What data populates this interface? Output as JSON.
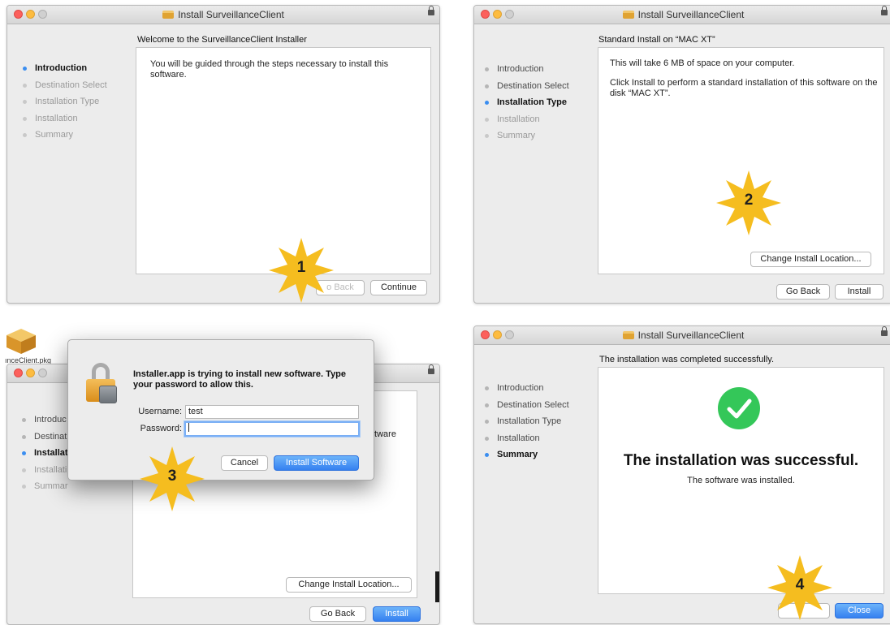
{
  "app_title": "Install SurveillanceClient",
  "steps": [
    "Introduction",
    "Destination Select",
    "Installation Type",
    "Installation",
    "Summary"
  ],
  "panel1": {
    "heading": "Welcome to the SurveillanceClient Installer",
    "text": "You will be guided through the steps necessary to install this software.",
    "go_back": "o Back",
    "continue": "Continue",
    "badge": "1"
  },
  "panel2": {
    "heading": "Standard Install on “MAC XT”",
    "space": "This will take 6 MB of space on your computer.",
    "instruction": "Click Install to perform a standard installation of this software on the disk “MAC XT”.",
    "change_location": "Change Install Location...",
    "go_back": "Go Back",
    "install": "Install",
    "badge": "2"
  },
  "panel3": {
    "file_label": "ınceClient.pkg",
    "steps_truncated": [
      "Introduc",
      "Destinat",
      "Installat",
      "Installati",
      "Summar"
    ],
    "behind_text": "ftware",
    "dialog_message": "Installer.app is trying to install new software. Type your password to allow this.",
    "username_label": "Username:",
    "username_value": "test",
    "password_label": "Password:",
    "password_value": "",
    "cancel": "Cancel",
    "install_software": "Install Software",
    "change_location": "Change Install Location...",
    "go_back": "Go Back",
    "install": "Install",
    "badge": "3"
  },
  "panel4": {
    "heading": "The installation was completed successfully.",
    "big": "The installation was successful.",
    "sub": "The software was installed.",
    "close": "Close",
    "badge": "4"
  },
  "colors": {
    "accent": "#3b8ef0",
    "success": "#34c759",
    "badge": "#f5bd1f"
  }
}
